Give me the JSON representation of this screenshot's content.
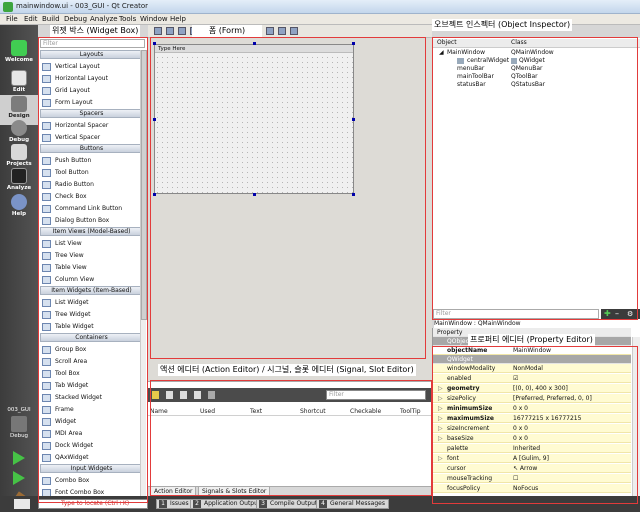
{
  "window": {
    "title": "mainwindow.ui - 003_GUI - Qt Creator"
  },
  "menu": [
    "File",
    "Edit",
    "Build",
    "Debug",
    "Analyze",
    "Tools",
    "Window",
    "Help"
  ],
  "modes": [
    {
      "label": "Welcome",
      "icon": "qt-logo-icon"
    },
    {
      "label": "Edit",
      "icon": "edit-document-icon"
    },
    {
      "label": "Design",
      "icon": "design-pencil-icon"
    },
    {
      "label": "Debug",
      "icon": "bug-icon"
    },
    {
      "label": "Projects",
      "icon": "projects-icon"
    },
    {
      "label": "Analyze",
      "icon": "analyze-icon"
    },
    {
      "label": "Help",
      "icon": "help-icon"
    }
  ],
  "kit": {
    "project": "003_GUI",
    "label": "Debug"
  },
  "widget_box": {
    "filter_placeholder": "Filter",
    "categories": [
      {
        "name": "Layouts",
        "items": [
          "Vertical Layout",
          "Horizontal Layout",
          "Grid Layout",
          "Form Layout"
        ]
      },
      {
        "name": "Spacers",
        "items": [
          "Horizontal Spacer",
          "Vertical Spacer"
        ]
      },
      {
        "name": "Buttons",
        "items": [
          "Push Button",
          "Tool Button",
          "Radio Button",
          "Check Box",
          "Command Link Button",
          "Dialog Button Box"
        ]
      },
      {
        "name": "Item Views (Model-Based)",
        "items": [
          "List View",
          "Tree View",
          "Table View",
          "Column View"
        ]
      },
      {
        "name": "Item Widgets (Item-Based)",
        "items": [
          "List Widget",
          "Tree Widget",
          "Table Widget"
        ]
      },
      {
        "name": "Containers",
        "items": [
          "Group Box",
          "Scroll Area",
          "Tool Box",
          "Tab Widget",
          "Stacked Widget",
          "Frame",
          "Widget",
          "MDI Area",
          "Dock Widget",
          "QAxWidget"
        ]
      },
      {
        "name": "Input Widgets",
        "items": [
          "Combo Box",
          "Font Combo Box",
          "Line Edit"
        ]
      }
    ]
  },
  "form": {
    "menu_placeholder": "Type Here"
  },
  "action_editor": {
    "filter_placeholder": "Filter",
    "columns": [
      "Name",
      "Used",
      "Text",
      "Shortcut",
      "Checkable",
      "ToolTip"
    ],
    "tabs": [
      "Action Editor",
      "Signals & Slots Editor"
    ]
  },
  "object_inspector": {
    "columns": [
      "Object",
      "Class"
    ],
    "rows": [
      {
        "object": "MainWindow",
        "class": "QMainWindow"
      },
      {
        "object": "centralWidget",
        "class": "QWidget"
      },
      {
        "object": "menuBar",
        "class": "QMenuBar"
      },
      {
        "object": "mainToolBar",
        "class": "QToolBar"
      },
      {
        "object": "statusBar",
        "class": "QStatusBar"
      }
    ],
    "filter_placeholder": "Filter",
    "status": "MainWindow : QMainWindow"
  },
  "property_editor": {
    "header": "Property",
    "group1": "QObject",
    "object_name": {
      "key": "objectName",
      "value": "MainWindow"
    },
    "group2": "QWidget",
    "rows": [
      {
        "key": "windowModality",
        "value": "NonModal"
      },
      {
        "key": "enabled",
        "value": "☑"
      },
      {
        "key": "geometry",
        "value": "[(0, 0), 400 x 300]"
      },
      {
        "key": "sizePolicy",
        "value": "[Preferred, Preferred, 0, 0]"
      },
      {
        "key": "minimumSize",
        "value": "0 x 0"
      },
      {
        "key": "maximumSize",
        "value": "16777215 x 16777215"
      },
      {
        "key": "sizeIncrement",
        "value": "0 x 0"
      },
      {
        "key": "baseSize",
        "value": "0 x 0"
      },
      {
        "key": "palette",
        "value": "Inherited"
      },
      {
        "key": "font",
        "value": "A  [Gulim, 9]"
      },
      {
        "key": "cursor",
        "value": "↖  Arrow"
      },
      {
        "key": "mouseTracking",
        "value": "☐"
      },
      {
        "key": "focusPolicy",
        "value": "NoFocus"
      }
    ]
  },
  "statusbar": {
    "locator_placeholder": "Type to locate (Ctrl+K)",
    "tabs": [
      {
        "n": "1",
        "label": "Issues"
      },
      {
        "n": "2",
        "label": "Application Output"
      },
      {
        "n": "3",
        "label": "Compile Output"
      },
      {
        "n": "4",
        "label": "General Messages"
      }
    ]
  },
  "annotations": {
    "widget_box": "위젯 박스 (Widget Box)",
    "form": "폼 (Form)",
    "object_inspector": "오브젝트 인스펙터 (Object Inspector)",
    "property_editor": "프로퍼티 에디터 (Property Editor)",
    "action_editor": "액션 에디터 (Action Editor) / 시그널, 슬롯 에디터 (Signal, Slot Editor)"
  },
  "colors": {
    "annotation_border": "#e23b3b",
    "property_row": "#fffbd2",
    "mode_bar": "#3c3c3c"
  }
}
